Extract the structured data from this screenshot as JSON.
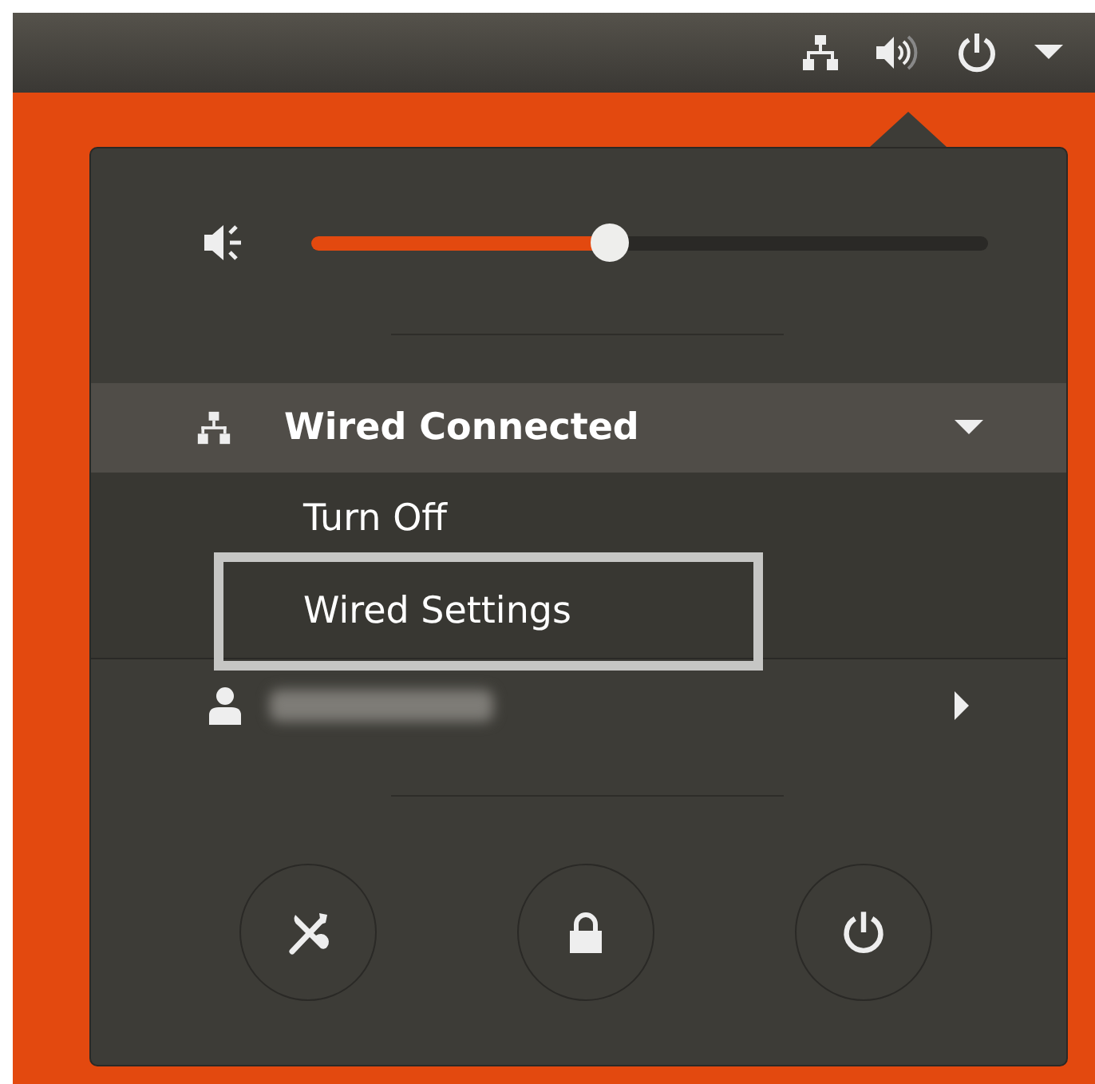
{
  "volume": {
    "level": 0.44
  },
  "network": {
    "title": "Wired Connected",
    "expanded": true,
    "items": [
      {
        "label": "Turn Off",
        "highlighted": false
      },
      {
        "label": "Wired Settings",
        "highlighted": true
      }
    ]
  },
  "user": {
    "name_redacted": true
  }
}
